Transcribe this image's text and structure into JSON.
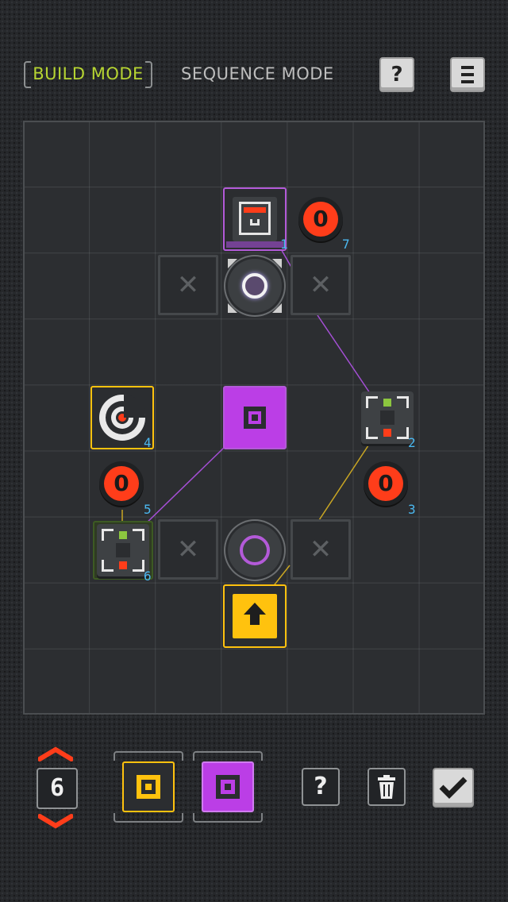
{
  "header": {
    "build_mode_label": "BUILD MODE",
    "sequence_mode_label": "SEQUENCE MODE",
    "help_label": "?"
  },
  "board": {
    "node_numbers": {
      "purple_top": "1",
      "sensor_right": "2",
      "counter_right": "3",
      "dial_left": "4",
      "counter_left": "5",
      "sensor_left": "6",
      "counter_top": "7"
    },
    "counter_values": {
      "top": "0",
      "left": "0",
      "right": "0"
    },
    "empty_slot_glyph": "✕"
  },
  "toolbar": {
    "count_value": "6",
    "help_label": "?"
  },
  "colors": {
    "build_active": "#b6d432",
    "purple": "#bb3ee6",
    "yellow": "#ffc20e",
    "red": "#ff3d1a",
    "number_blue": "#4bb8f0",
    "green": "#8cc63f"
  },
  "icons": {
    "help": "question-mark-icon",
    "menu": "hamburger-menu-icon",
    "delete": "trash-icon",
    "confirm": "checkmark-icon",
    "count_up": "chevron-up-icon",
    "count_down": "chevron-down-icon"
  }
}
